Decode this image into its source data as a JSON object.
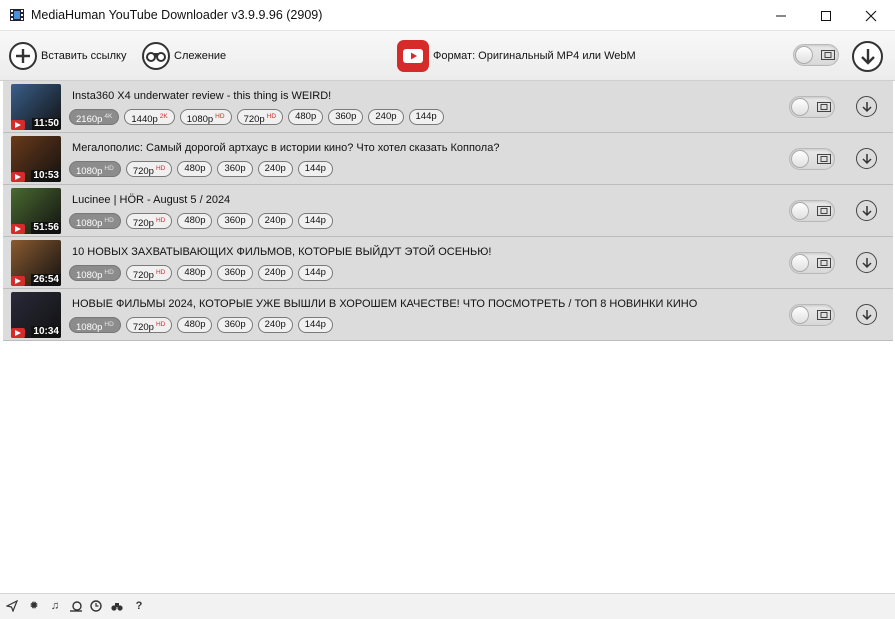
{
  "window": {
    "title": "MediaHuman YouTube Downloader v3.9.9.96 (2909)"
  },
  "toolbar": {
    "paste_label": "Вставить ссылку",
    "tracking_label": "Слежение",
    "format_label": "Формат: Оригинальный MP4 или WebM"
  },
  "videos": [
    {
      "title": "Insta360 X4 underwater review - this thing is WEIRD!",
      "duration": "11:50",
      "formats": [
        {
          "label": "2160p",
          "tag": "4K",
          "selected": true
        },
        {
          "label": "1440p",
          "tag": "2K"
        },
        {
          "label": "1080p",
          "tag": "HD"
        },
        {
          "label": "720p",
          "tag": "HD"
        },
        {
          "label": "480p"
        },
        {
          "label": "360p"
        },
        {
          "label": "240p"
        },
        {
          "label": "144p"
        }
      ]
    },
    {
      "title": "Мегалополис: Самый дорогой артхаус в истории кино? Что хотел сказать Коппола?",
      "duration": "10:53",
      "formats": [
        {
          "label": "1080p",
          "tag": "HD",
          "selected": true
        },
        {
          "label": "720p",
          "tag": "HD"
        },
        {
          "label": "480p"
        },
        {
          "label": "360p"
        },
        {
          "label": "240p"
        },
        {
          "label": "144p"
        }
      ]
    },
    {
      "title": "Lucinee | HÖR - August 5 / 2024",
      "duration": "51:56",
      "formats": [
        {
          "label": "1080p",
          "tag": "HD",
          "selected": true
        },
        {
          "label": "720p",
          "tag": "HD"
        },
        {
          "label": "480p"
        },
        {
          "label": "360p"
        },
        {
          "label": "240p"
        },
        {
          "label": "144p"
        }
      ]
    },
    {
      "title": "10 НОВЫХ ЗАХВАТЫВАЮЩИХ ФИЛЬМОВ, КОТОРЫЕ ВЫЙДУТ ЭТОЙ ОСЕНЬЮ!",
      "duration": "26:54",
      "formats": [
        {
          "label": "1080p",
          "tag": "HD",
          "selected": true
        },
        {
          "label": "720p",
          "tag": "HD"
        },
        {
          "label": "480p"
        },
        {
          "label": "360p"
        },
        {
          "label": "240p"
        },
        {
          "label": "144p"
        }
      ]
    },
    {
      "title": "НОВЫЕ ФИЛЬМЫ 2024, КОТОРЫЕ УЖЕ ВЫШЛИ В ХОРОШЕМ КАЧЕСТВЕ! ЧТО ПОСМОТРЕТЬ / ТОП 8 НОВИНКИ КИНО",
      "duration": "10:34",
      "formats": [
        {
          "label": "1080p",
          "tag": "HD",
          "selected": true
        },
        {
          "label": "720p",
          "tag": "HD"
        },
        {
          "label": "480p"
        },
        {
          "label": "360p"
        },
        {
          "label": "240p"
        },
        {
          "label": "144p"
        }
      ]
    }
  ],
  "thumb_colors": [
    "#3a5f8a",
    "#6a3a1a",
    "#4a6a30",
    "#8a5a30",
    "#2a2a3a"
  ],
  "statusbar_icons": [
    "send-icon",
    "gear-icon",
    "music-note-icon",
    "snail-icon",
    "clock-icon",
    "binoculars-icon",
    "help-icon"
  ],
  "colors": {
    "accent_red": "#d52b2b",
    "row_bg": "#dcdcdc",
    "selected_chip": "#8c8c8c"
  }
}
